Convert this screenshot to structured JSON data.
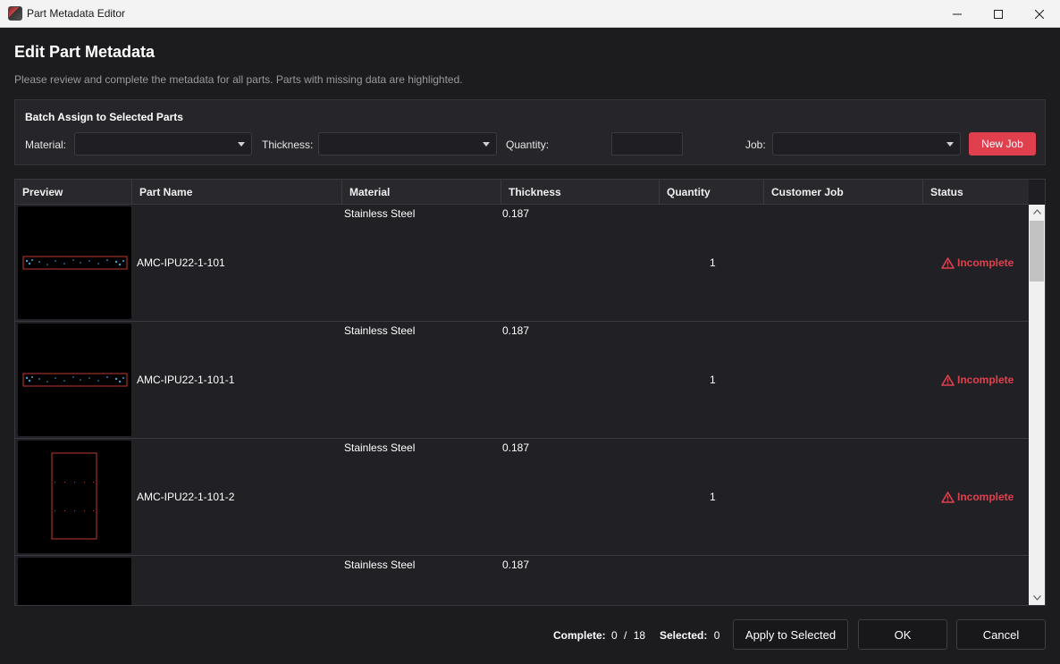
{
  "window": {
    "title": "Part Metadata Editor",
    "controls": [
      "minimize-icon",
      "maximize-icon",
      "close-icon"
    ]
  },
  "header": {
    "title": "Edit Part Metadata",
    "description": "Please review and complete the metadata for all parts. Parts with missing data are highlighted."
  },
  "batch": {
    "title": "Batch Assign to Selected Parts",
    "material_label": "Material:",
    "material_value": "",
    "thickness_label": "Thickness:",
    "thickness_value": "",
    "quantity_label": "Quantity:",
    "quantity_value": "",
    "job_label": "Job:",
    "job_value": "",
    "new_job_button": "New Job"
  },
  "table": {
    "columns": [
      "Preview",
      "Part Name",
      "Material",
      "Thickness",
      "Quantity",
      "Customer Job",
      "Status"
    ],
    "rows": [
      {
        "part_name": "AMC-IPU22-1-101",
        "material": "Stainless Steel",
        "thickness": "0.187",
        "quantity": "1",
        "customer_job": "",
        "status": "Incomplete",
        "preview": "strip"
      },
      {
        "part_name": "AMC-IPU22-1-101-1",
        "material": "Stainless Steel",
        "thickness": "0.187",
        "quantity": "1",
        "customer_job": "",
        "status": "Incomplete",
        "preview": "strip"
      },
      {
        "part_name": "AMC-IPU22-1-101-2",
        "material": "Stainless Steel",
        "thickness": "0.187",
        "quantity": "1",
        "customer_job": "",
        "status": "Incomplete",
        "preview": "rect"
      },
      {
        "part_name": "",
        "material": "Stainless Steel",
        "thickness": "0.187",
        "quantity": "",
        "customer_job": "",
        "status": "",
        "preview": "blank"
      }
    ]
  },
  "footer": {
    "complete_label": "Complete:",
    "complete_value": "0",
    "separator": "/",
    "total_value": "18",
    "selected_label": "Selected:",
    "selected_value": "0",
    "apply_button": "Apply to Selected",
    "ok_button": "OK",
    "cancel_button": "Cancel"
  },
  "colors": {
    "accent": "#e0404e",
    "background": "#1c1c1f",
    "part_outline": "#c0392b",
    "part_holes": "#3aa3d9"
  }
}
